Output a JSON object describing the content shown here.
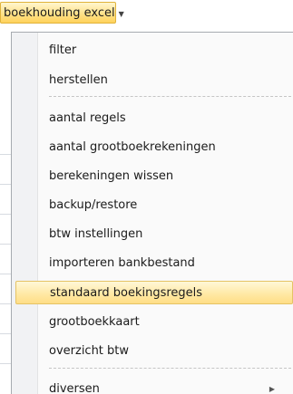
{
  "ribbon": {
    "button_label": "boekhouding excel"
  },
  "menu": {
    "items": [
      {
        "label": "filter"
      },
      {
        "label": "herstellen"
      },
      {
        "label": "aantal regels"
      },
      {
        "label": "aantal grootboekrekeningen"
      },
      {
        "label": "berekeningen wissen"
      },
      {
        "label": "backup/restore"
      },
      {
        "label": "btw instellingen"
      },
      {
        "label": "importeren bankbestand"
      },
      {
        "label": "standaard boekingsregels",
        "highlighted": true
      },
      {
        "label": "grootboekkaart"
      },
      {
        "label": "overzicht btw"
      },
      {
        "label": "diversen",
        "has_submenu": true
      }
    ]
  },
  "colors": {
    "highlight": "#ffe9a6",
    "highlight_border": "#e5c365",
    "menu_background": "#fafafa"
  },
  "icons": {
    "dropdown": "chevron-down-icon",
    "submenu": "chevron-right-icon"
  }
}
